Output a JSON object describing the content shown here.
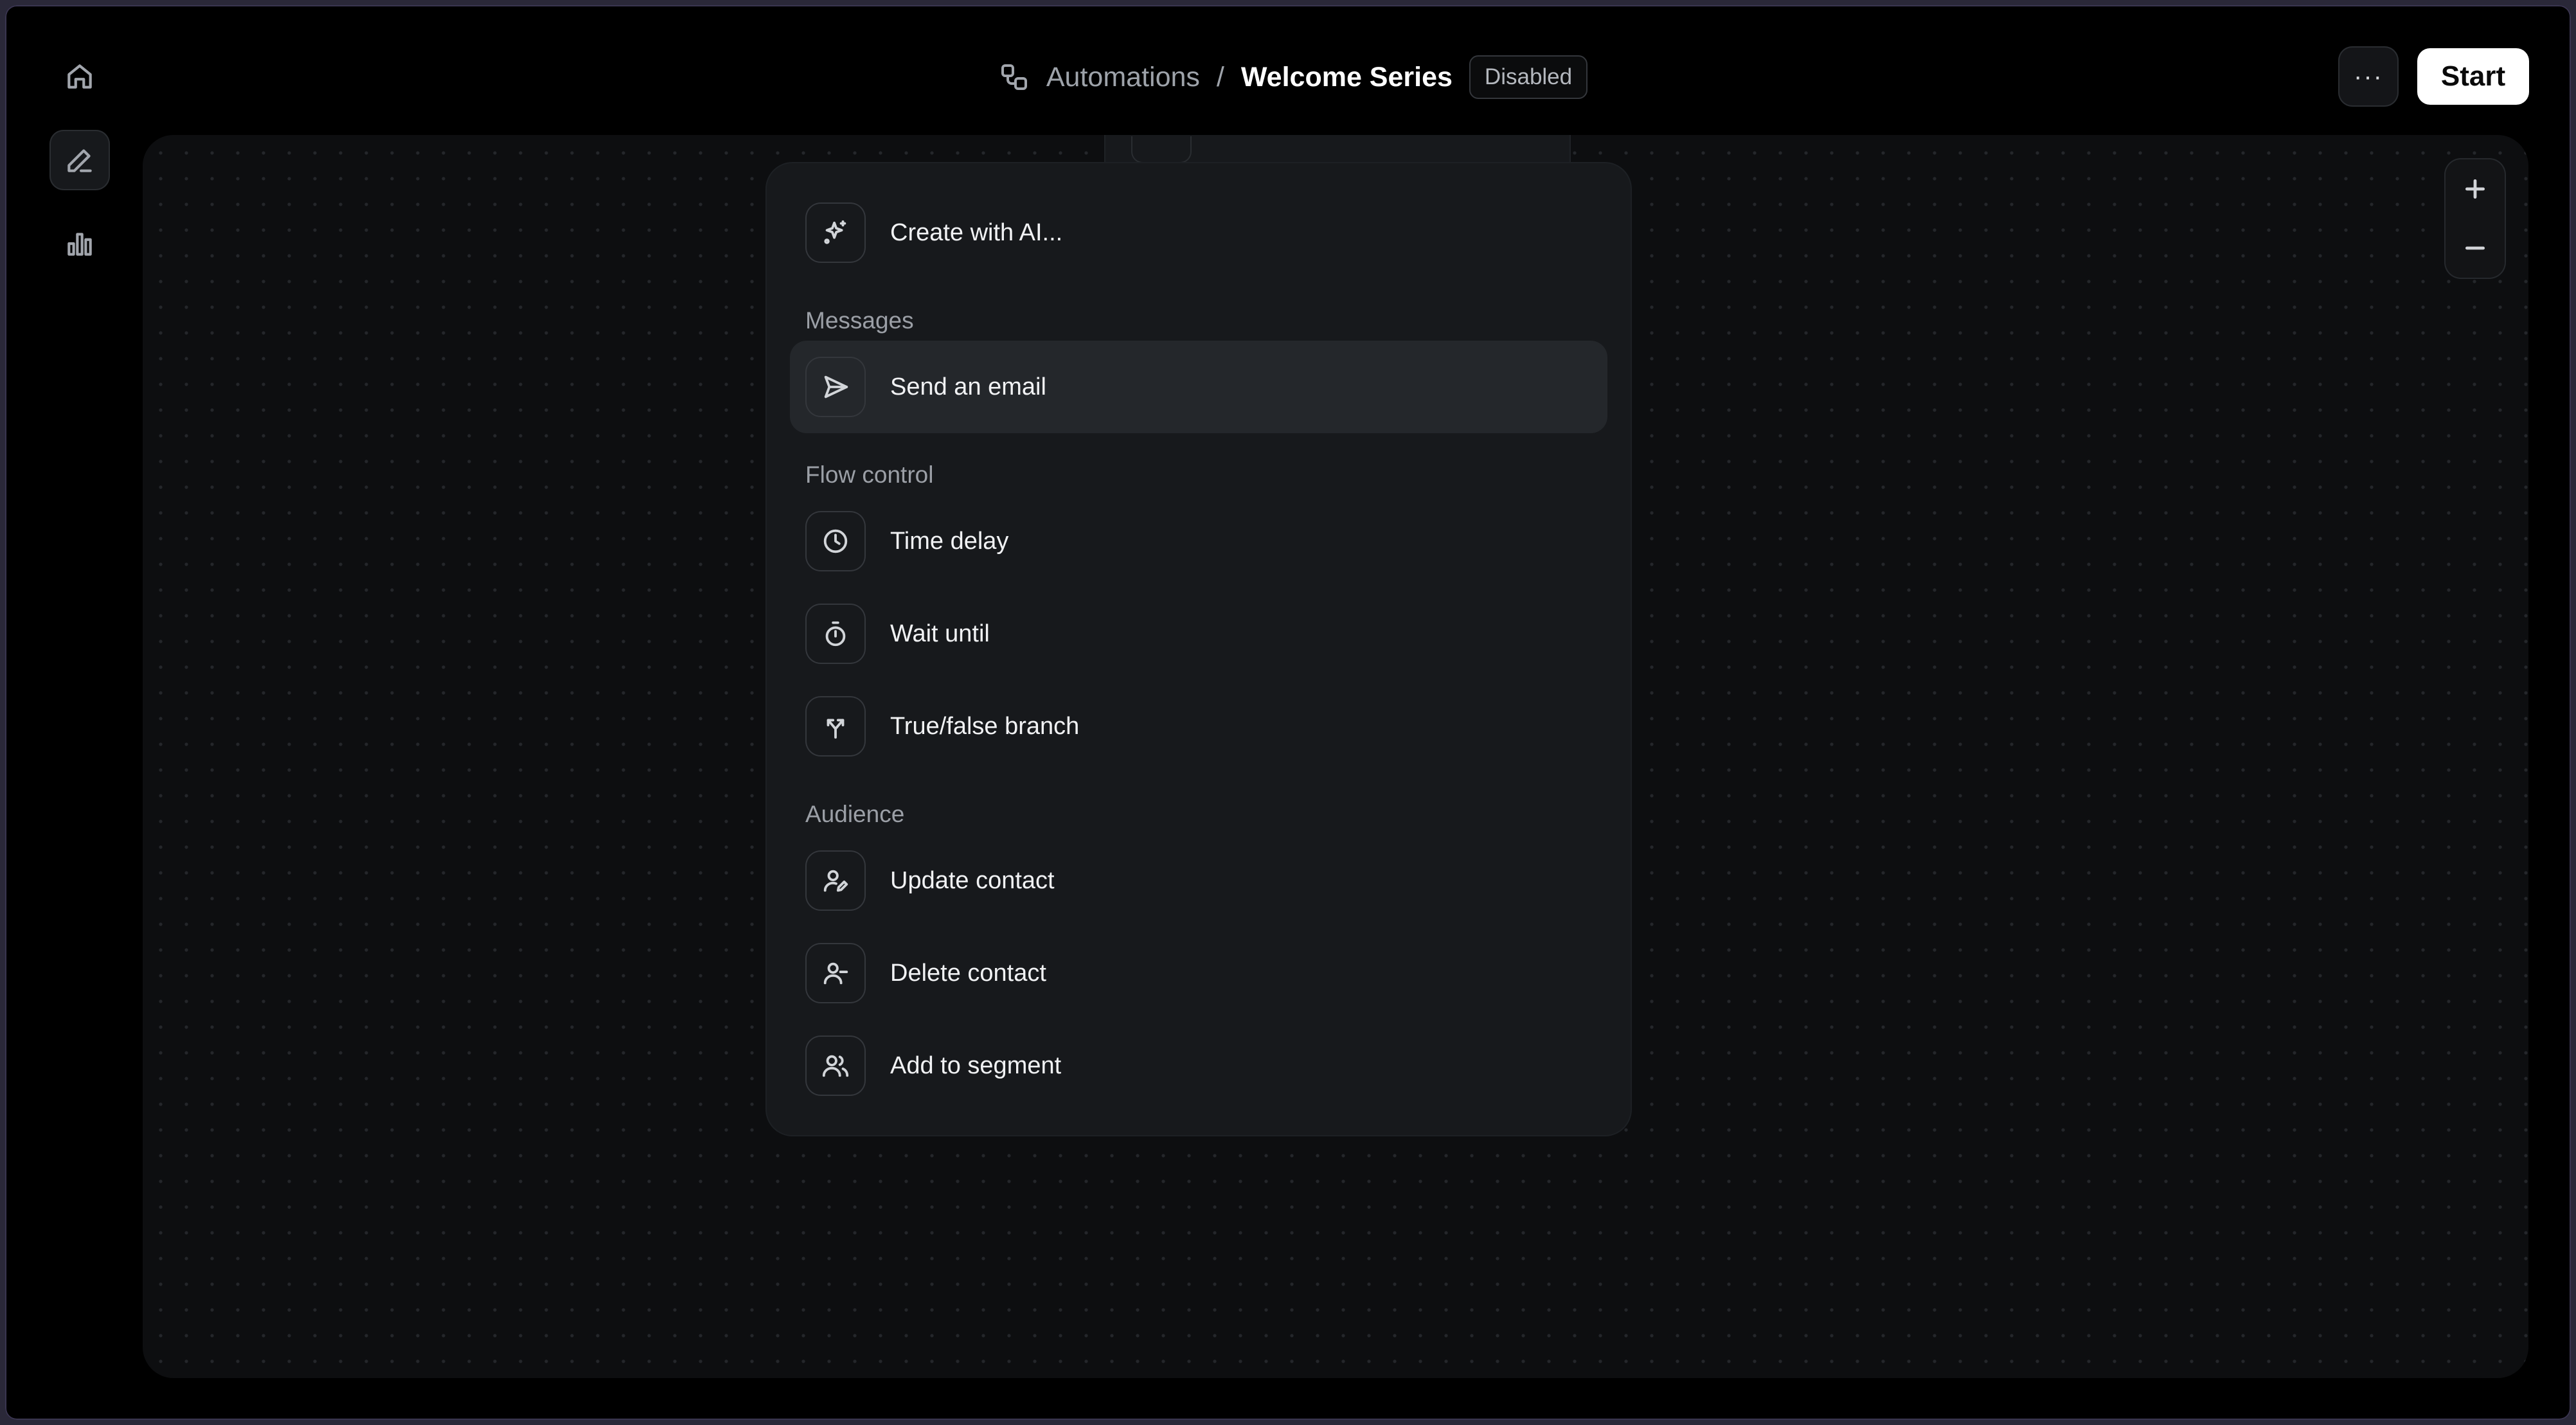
{
  "breadcrumb": {
    "parent": "Automations",
    "separator": "/",
    "title": "Welcome Series",
    "status": "Disabled"
  },
  "header": {
    "more_label": "···",
    "start_label": "Start"
  },
  "sidebar": {
    "items": [
      {
        "name": "home",
        "icon": "home-icon",
        "active": false
      },
      {
        "name": "editor",
        "icon": "pencil-icon",
        "active": true
      },
      {
        "name": "analytics",
        "icon": "bar-chart-icon",
        "active": false
      }
    ]
  },
  "menu": {
    "create_ai": "Create with AI...",
    "sections": {
      "messages": "Messages",
      "flow_control": "Flow control",
      "audience": "Audience"
    },
    "items": {
      "send_email": "Send an email",
      "time_delay": "Time delay",
      "wait_until": "Wait until",
      "branch": "True/false branch",
      "update_contact": "Update contact",
      "delete_contact": "Delete contact",
      "add_segment": "Add to segment"
    },
    "highlighted_item": "Send an email"
  },
  "zoom": {
    "in_icon": "plus-icon",
    "out_icon": "minus-icon"
  },
  "colors": {
    "background": "#000000",
    "canvas": "#0d0e10",
    "menu": "#17191c",
    "highlight": "#24272b",
    "start_button": "#ffffff"
  }
}
